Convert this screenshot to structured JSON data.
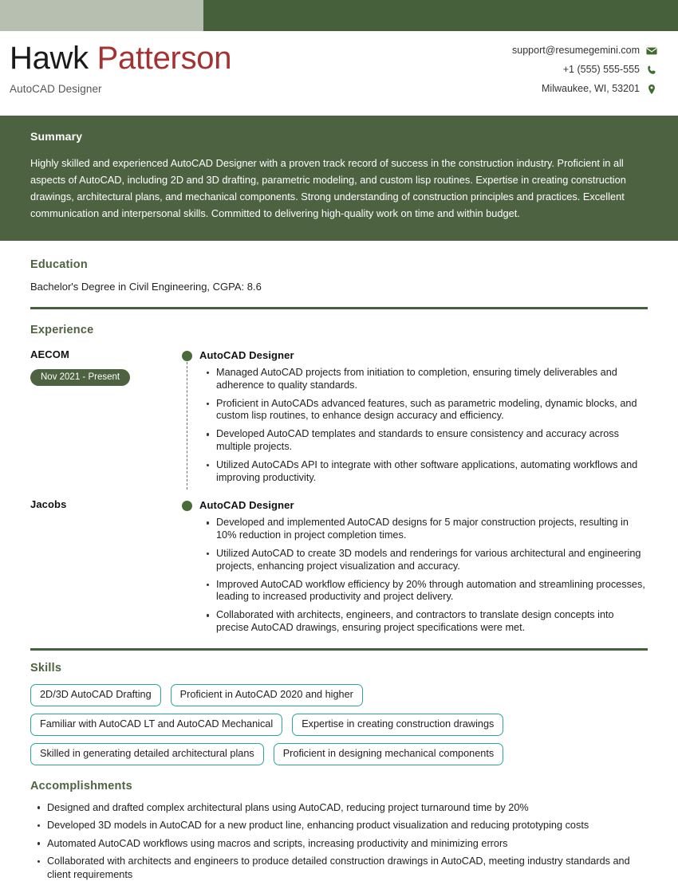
{
  "theme": {
    "accent_dark_green": "#47603c",
    "panel_green": "#4c6241",
    "light_sage": "#b7c0b0",
    "heading_green": "#4f6340",
    "name_accent_red": "#a33232",
    "chip_border_teal": "#2aa79b"
  },
  "header": {
    "first_name": "Hawk",
    "last_name": "Patterson",
    "job_title": "AutoCAD Designer",
    "contact": [
      {
        "text": "support@resumegemini.com",
        "icon": "envelope-icon"
      },
      {
        "text": "+1 (555) 555-555",
        "icon": "phone-icon"
      },
      {
        "text": "Milwaukee, WI, 53201",
        "icon": "location-pin-icon"
      }
    ]
  },
  "summary": {
    "title": "Summary",
    "text": "Highly skilled and experienced AutoCAD Designer with a proven track record of success in the construction industry. Proficient in all aspects of AutoCAD, including 2D and 3D drafting, parametric modeling, and custom lisp routines. Expertise in creating construction drawings, architectural plans, and mechanical components. Strong understanding of construction principles and practices. Excellent communication and interpersonal skills. Committed to delivering high-quality work on time and within budget."
  },
  "education": {
    "title": "Education",
    "entry": "Bachelor's Degree in Civil Engineering, CGPA: 8.6"
  },
  "experience": {
    "title": "Experience",
    "entries": [
      {
        "company": "AECOM",
        "date": "Nov 2021 - Present",
        "role": "AutoCAD Designer",
        "bullets": [
          "Managed AutoCAD projects from initiation to completion, ensuring timely deliverables and adherence to quality standards.",
          "Proficient in AutoCADs advanced features, such as parametric modeling, dynamic blocks, and custom lisp routines, to enhance design accuracy and efficiency.",
          "Developed AutoCAD templates and standards to ensure consistency and accuracy across multiple projects.",
          "Utilized AutoCADs API to integrate with other software applications, automating workflows and improving productivity."
        ]
      },
      {
        "company": "Jacobs",
        "date": "",
        "role": "AutoCAD Designer",
        "bullets": [
          "Developed and implemented AutoCAD designs for 5 major construction projects, resulting in 10% reduction in project completion times.",
          "Utilized AutoCAD to create 3D models and renderings for various architectural and engineering projects, enhancing project visualization and accuracy.",
          "Improved AutoCAD workflow efficiency by 20% through automation and streamlining processes, leading to increased productivity and project delivery.",
          "Collaborated with architects, engineers, and contractors to translate design concepts into precise AutoCAD drawings, ensuring project specifications were met."
        ]
      }
    ]
  },
  "skills": {
    "title": "Skills",
    "items": [
      "2D/3D AutoCAD Drafting",
      "Proficient in AutoCAD 2020 and higher",
      "Familiar with AutoCAD LT and AutoCAD Mechanical",
      "Expertise in creating construction drawings",
      "Skilled in generating detailed architectural plans",
      "Proficient in designing mechanical components"
    ]
  },
  "accomplishments": {
    "title": "Accomplishments",
    "items": [
      "Designed and drafted complex architectural plans using AutoCAD, reducing project turnaround time by 20%",
      "Developed 3D models in AutoCAD for a new product line, enhancing product visualization and reducing prototyping costs",
      "Automated AutoCAD workflows using macros and scripts, increasing productivity and minimizing errors",
      "Collaborated with architects and engineers to produce detailed construction drawings in AutoCAD, meeting industry standards and client requirements"
    ]
  }
}
